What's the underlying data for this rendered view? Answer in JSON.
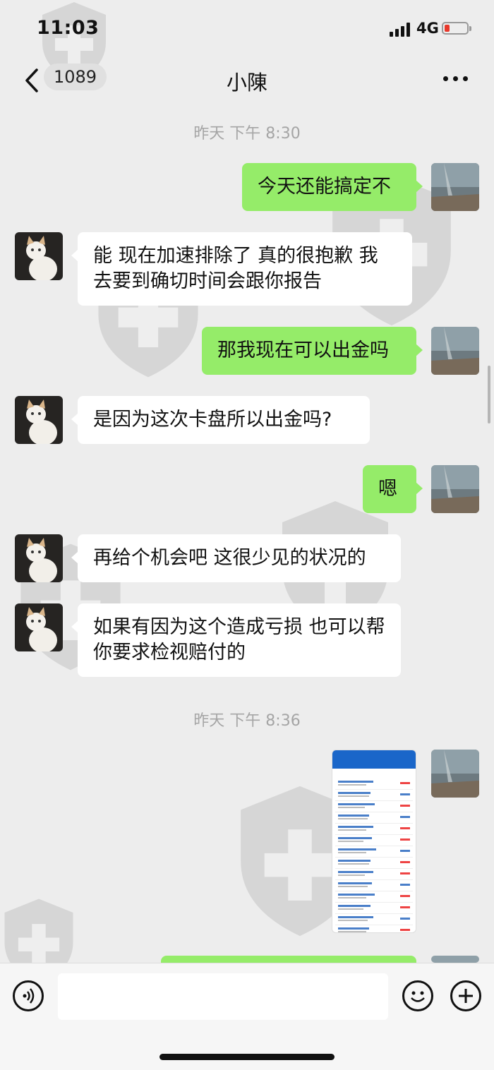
{
  "status": {
    "time": "11:03",
    "network": "4G"
  },
  "header": {
    "back_count": "1089",
    "title": "小陳"
  },
  "messages": [
    {
      "type": "time",
      "text": "昨天 下午 8:30"
    },
    {
      "type": "me",
      "text": "今天还能搞定不"
    },
    {
      "type": "other",
      "text": "能 现在加速排除了 真的很抱歉 我去要到确切时间会跟你报告"
    },
    {
      "type": "me",
      "text": "那我现在可以出金吗"
    },
    {
      "type": "other",
      "text": "是因为这次卡盘所以出金吗?"
    },
    {
      "type": "me",
      "text": "嗯"
    },
    {
      "type": "other",
      "text": "再给个机会吧 这很少见的状况的"
    },
    {
      "type": "other",
      "text": "如果有因为这个造成亏损 也可以帮你要求检视赔付的"
    },
    {
      "type": "time",
      "text": "昨天 下午 8:36"
    },
    {
      "type": "me-image",
      "text": ""
    }
  ],
  "icons": {
    "back": "chevron-left-icon",
    "more": "more-dots-icon",
    "voice": "voice-icon",
    "emoji": "emoji-icon",
    "add": "plus-icon"
  },
  "colors": {
    "my_bubble": "#95ec69",
    "other_bubble": "#ffffff",
    "background": "#ededed",
    "battery_low": "#e8382b"
  }
}
